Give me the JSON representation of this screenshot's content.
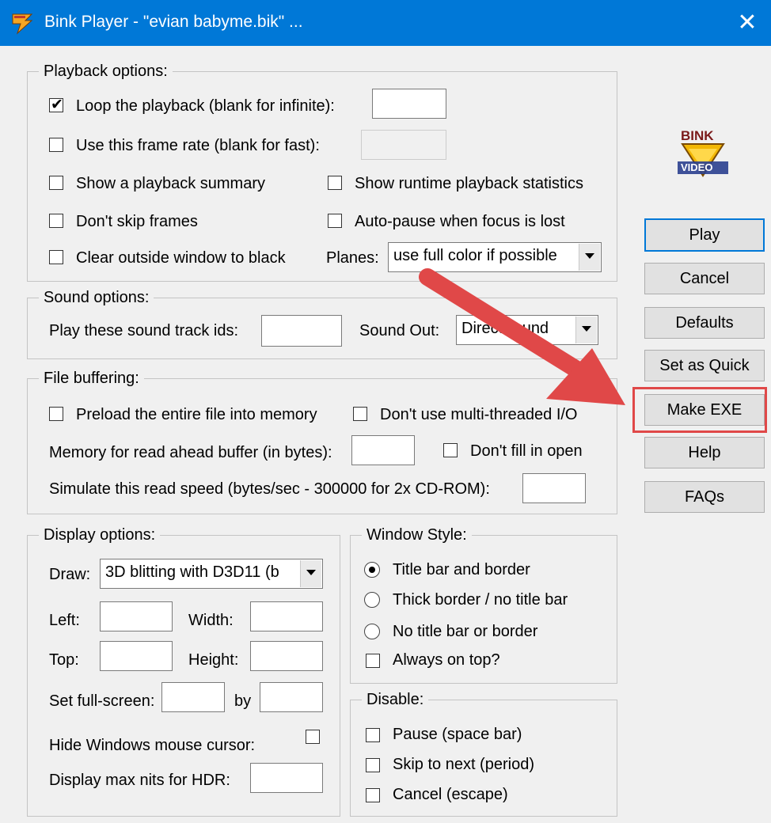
{
  "window": {
    "title": "Bink Player - \"evian babyme.bik\" ...",
    "close_glyph": "✕",
    "accent": "#0078d7"
  },
  "logo": {
    "line1": "BINK",
    "line2": "VIDEO"
  },
  "playback": {
    "legend": "Playback options:",
    "loop_label": "Loop the playback (blank for infinite):",
    "loop_checked": true,
    "loop_value": "",
    "framerate_label": "Use this frame rate (blank for fast):",
    "framerate_value": "",
    "summary_label": "Show a playback summary",
    "runtime_stats_label": "Show runtime playback statistics",
    "dont_skip_label": "Don't skip frames",
    "autopause_label": "Auto-pause when focus is lost",
    "clear_label": "Clear outside window to black",
    "planes_label": "Planes:",
    "planes_value": "use full color if possible"
  },
  "sound": {
    "legend": "Sound options:",
    "track_ids_label": "Play these sound track ids:",
    "track_ids_value": "",
    "sound_out_label": "Sound Out:",
    "sound_out_value": "DirectSound"
  },
  "buffering": {
    "legend": "File buffering:",
    "preload_label": "Preload the entire file into memory",
    "no_multithread_label": "Don't use multi-threaded I/O",
    "readahead_label": "Memory for read ahead buffer (in bytes):",
    "readahead_value": "",
    "dont_fill_label": "Don't fill in open",
    "speed_label": "Simulate this read speed (bytes/sec - 300000 for 2x CD-ROM):",
    "speed_value": ""
  },
  "display": {
    "legend": "Display options:",
    "draw_label": "Draw:",
    "draw_value": "3D blitting with D3D11 (b",
    "left_label": "Left:",
    "width_label": "Width:",
    "top_label": "Top:",
    "height_label": "Height:",
    "fullscreen_label": "Set full-screen:",
    "by_label": "by",
    "hide_cursor_label": "Hide Windows mouse cursor:",
    "max_nits_label": "Display max nits for HDR:"
  },
  "window_style": {
    "legend": "Window Style:",
    "options": [
      "Title bar and border",
      "Thick border / no title bar",
      "No title bar or border"
    ],
    "selected": 0,
    "always_on_top_label": "Always on top?"
  },
  "disable": {
    "legend": "Disable:",
    "pause_label": "Pause (space bar)",
    "skip_label": "Skip to next (period)",
    "cancel_label": "Cancel (escape)"
  },
  "buttons": {
    "play": "Play",
    "cancel": "Cancel",
    "defaults": "Defaults",
    "set_as_quick": "Set as Quick",
    "make_exe": "Make EXE",
    "help": "Help",
    "faqs": "FAQs"
  },
  "annotation": {
    "color": "#e04848"
  }
}
